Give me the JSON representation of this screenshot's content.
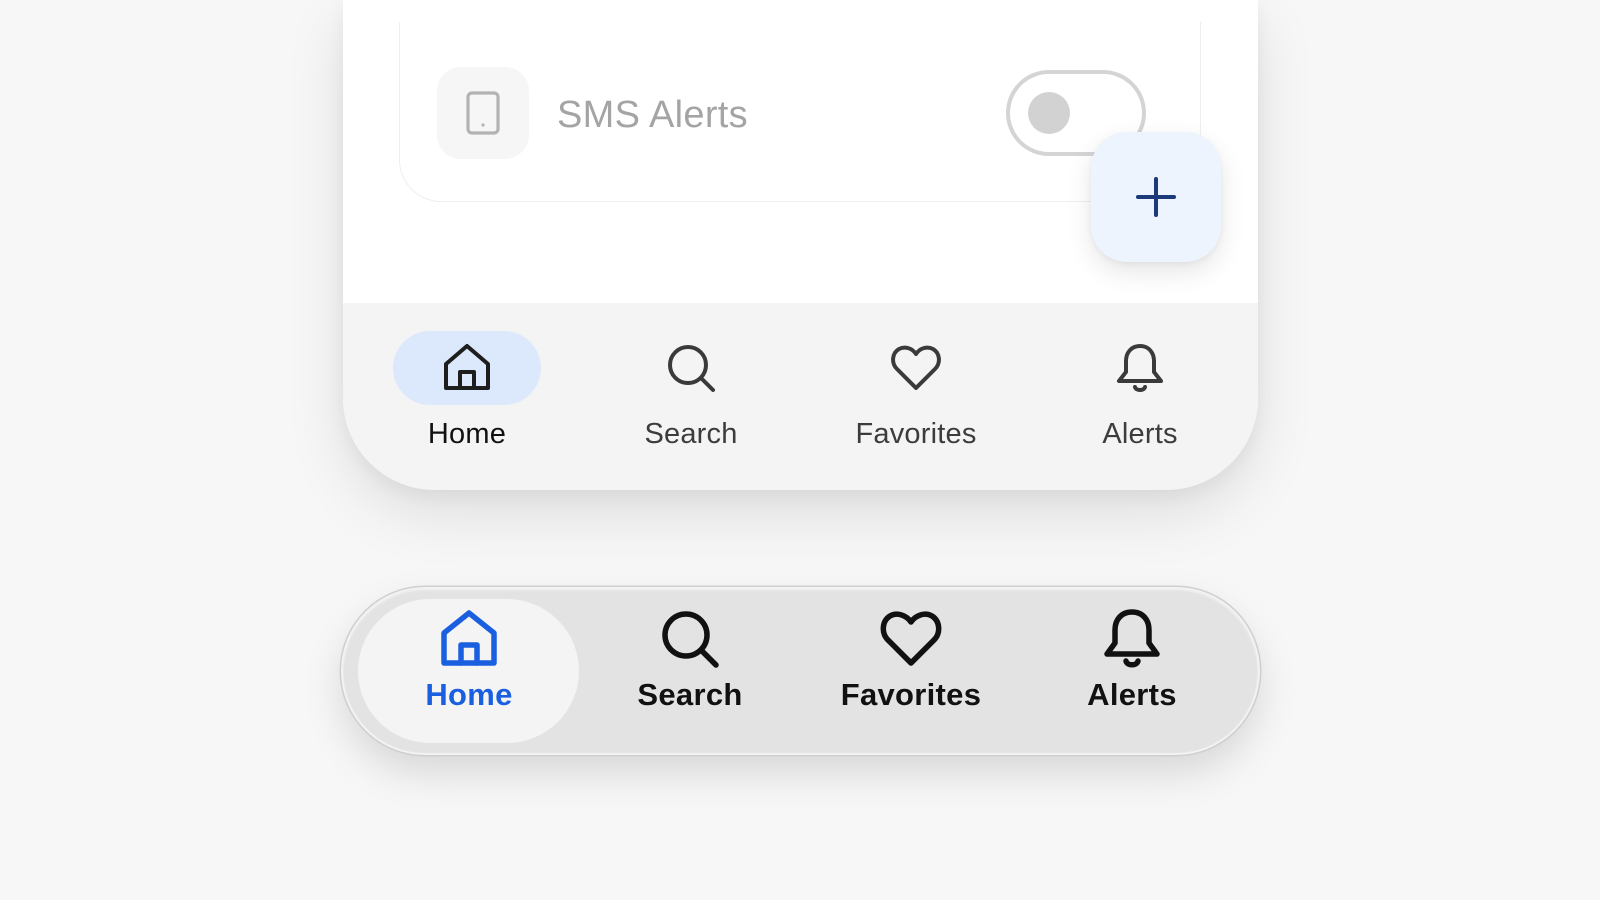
{
  "settings": {
    "sms_alerts": {
      "label": "SMS Alerts",
      "icon": "phone-icon",
      "enabled": false
    }
  },
  "fab": {
    "icon": "plus-icon",
    "icon_color": "#1c3a7a",
    "background": "#eef4fd"
  },
  "bottom_nav": {
    "active": "Home",
    "items": [
      {
        "label": "Home",
        "icon": "home-icon"
      },
      {
        "label": "Search",
        "icon": "search-icon"
      },
      {
        "label": "Favorites",
        "icon": "heart-icon"
      },
      {
        "label": "Alerts",
        "icon": "bell-icon"
      }
    ],
    "active_pill_color": "#dce8fb"
  },
  "floating_nav": {
    "active": "Home",
    "items": [
      {
        "label": "Home",
        "icon": "home-icon"
      },
      {
        "label": "Search",
        "icon": "search-icon"
      },
      {
        "label": "Favorites",
        "icon": "heart-icon"
      },
      {
        "label": "Alerts",
        "icon": "bell-icon"
      }
    ],
    "active_color": "#1a5fe0"
  }
}
